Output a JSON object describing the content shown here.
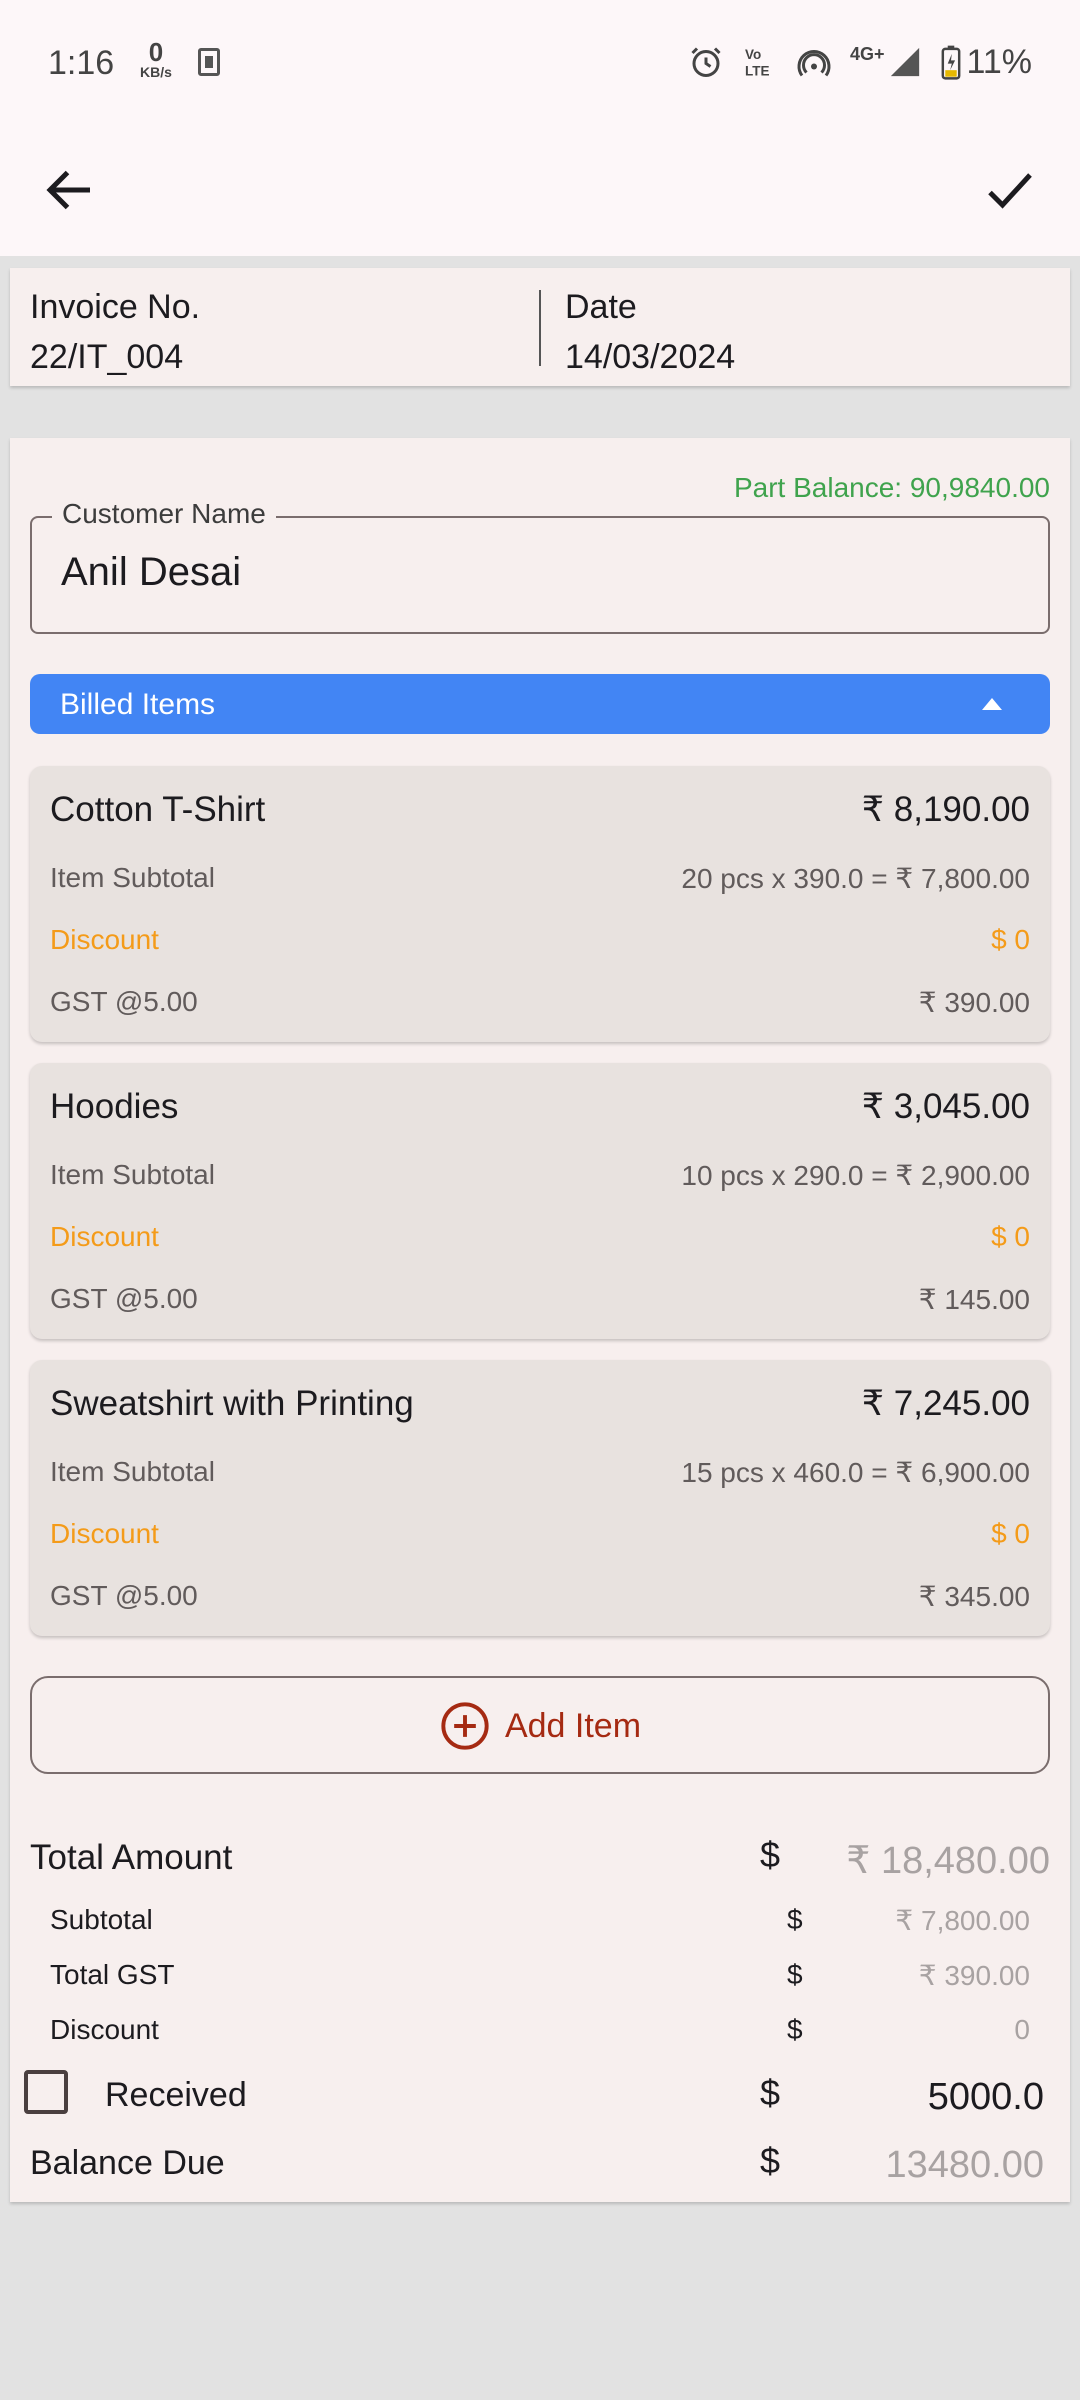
{
  "status_bar": {
    "time": "1:16",
    "net_speed_value": "0",
    "net_speed_unit": "KB/s",
    "battery": "11%",
    "network": "4G+",
    "icons": [
      "sim-icon",
      "alarm-icon",
      "volte-icon",
      "hotspot-icon",
      "signal-icon",
      "battery-charging-icon"
    ]
  },
  "app_bar": {
    "back_icon": "arrow-left-icon",
    "confirm_icon": "check-icon"
  },
  "invoice": {
    "number_label": "Invoice No.",
    "number_value": "22/IT_004",
    "date_label": "Date",
    "date_value": "14/03/2024"
  },
  "customer": {
    "part_balance": "Part Balance: 90,9840.00",
    "label": "Customer Name",
    "value": "Anil Desai"
  },
  "billed_items": {
    "header": "Billed Items",
    "items": [
      {
        "name": "Cotton T-Shirt",
        "total": "₹ 8,190.00",
        "subtotal_label": "Item Subtotal",
        "subtotal_value": "20 pcs x 390.0 = ₹ 7,800.00",
        "discount_label": "Discount",
        "discount_value": "$ 0",
        "gst_label": "GST @5.00",
        "gst_value": "₹ 390.00"
      },
      {
        "name": "Hoodies",
        "total": "₹ 3,045.00",
        "subtotal_label": "Item Subtotal",
        "subtotal_value": "10 pcs x 290.0 = ₹ 2,900.00",
        "discount_label": "Discount",
        "discount_value": "$ 0",
        "gst_label": "GST @5.00",
        "gst_value": "₹ 145.00"
      },
      {
        "name": "Sweatshirt with Printing",
        "total": "₹ 7,245.00",
        "subtotal_label": "Item Subtotal",
        "subtotal_value": "15 pcs x 460.0 = ₹ 6,900.00",
        "discount_label": "Discount",
        "discount_value": "$ 0",
        "gst_label": "GST @5.00",
        "gst_value": "₹ 345.00"
      }
    ],
    "add_item_label": "Add Item"
  },
  "totals": {
    "currency_symbol": "$",
    "total_amount_label": "Total Amount",
    "total_amount_value": "₹ 18,480.00",
    "subtotal_label": "Subtotal",
    "subtotal_value": "₹ 7,800.00",
    "gst_label": "Total GST",
    "gst_value": "₹ 390.00",
    "discount_label": "Discount",
    "discount_value": "0",
    "received_label": "Received",
    "received_value": "5000.0",
    "received_checked": false,
    "balance_label": "Balance Due",
    "balance_value": "13480.00"
  },
  "colors": {
    "accent_blue": "#4285f4",
    "part_balance_green": "#3fa34d",
    "discount_orange": "#f49b19",
    "add_item_red": "#a52a12"
  }
}
